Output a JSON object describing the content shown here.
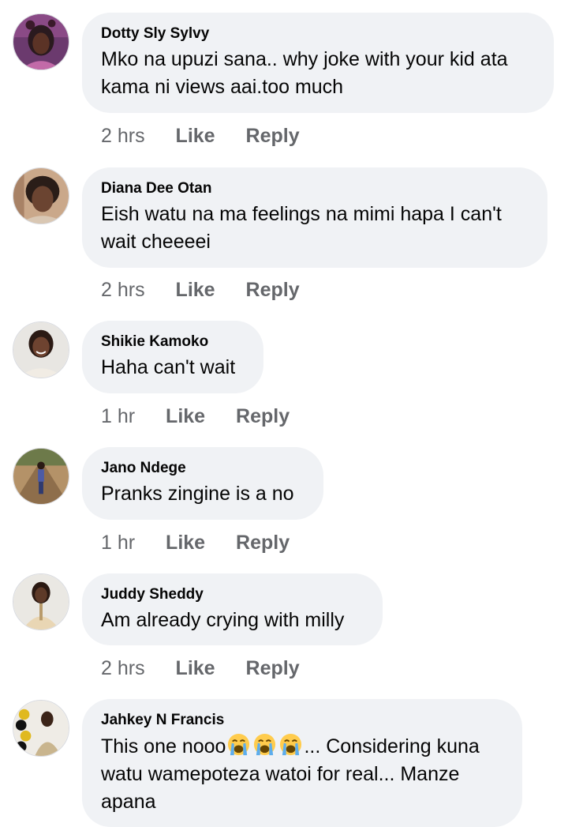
{
  "comments": [
    {
      "author": "Dotty Sly Sylvy",
      "text": "Mko na upuzi sana.. why joke with your kid ata kama ni views aai.too much",
      "time": "2 hrs",
      "like_label": "Like",
      "reply_label": "Reply"
    },
    {
      "author": "Diana Dee Otan",
      "text": "Eish watu na ma feelings na mimi hapa I can't wait cheeeei",
      "time": "2 hrs",
      "like_label": "Like",
      "reply_label": "Reply"
    },
    {
      "author": "Shikie Kamoko",
      "text": "Haha can't wait",
      "time": "1 hr",
      "like_label": "Like",
      "reply_label": "Reply"
    },
    {
      "author": "Jano Ndege",
      "text": "Pranks zingine is a no",
      "time": "1 hr",
      "like_label": "Like",
      "reply_label": "Reply"
    },
    {
      "author": "Juddy Sheddy",
      "text": "Am already crying with milly",
      "time": "2 hrs",
      "like_label": "Like",
      "reply_label": "Reply"
    },
    {
      "author": "Jahkey N Francis",
      "text_before": "This one nooo",
      "emoji": [
        "crying-face",
        "crying-face",
        "crying-face"
      ],
      "text_after": "... Considering kuna watu wamepoteza watoi for real... Manze apana"
    }
  ],
  "colors": {
    "bubble_bg": "#f0f2f5",
    "meta_text": "#65676b",
    "body_text": "#050505"
  }
}
